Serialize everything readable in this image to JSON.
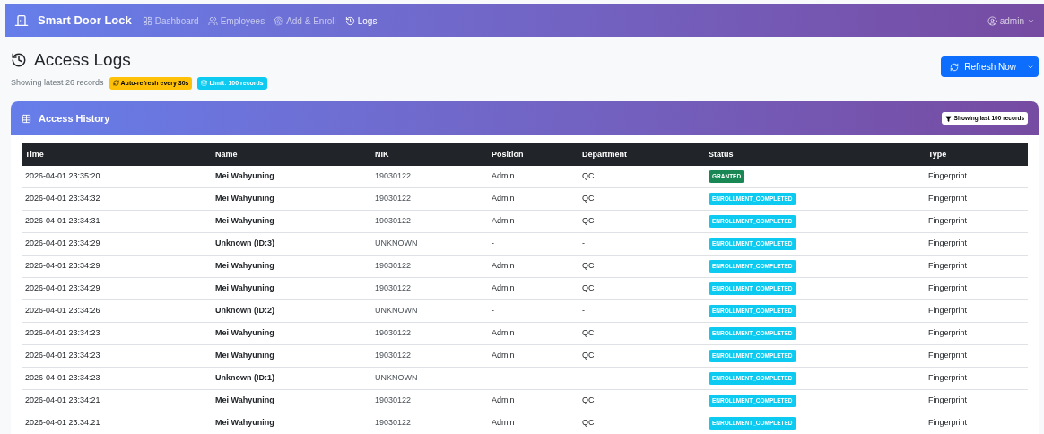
{
  "navbar": {
    "brand": "Smart Door Lock",
    "items": [
      {
        "label": "Dashboard",
        "kind": "dashboard",
        "selected": false
      },
      {
        "label": "Employees",
        "kind": "users",
        "selected": false
      },
      {
        "label": "Add & Enroll",
        "kind": "enroll",
        "selected": false
      },
      {
        "label": "Logs",
        "kind": "logs",
        "selected": true
      }
    ],
    "user": "admin"
  },
  "header": {
    "title": "Access Logs",
    "subtitle": "Showing latest 26 records",
    "badges": [
      {
        "label": "Auto-refresh every 30s",
        "kind": "warning"
      },
      {
        "label": "Limit: 100 records",
        "kind": "info"
      }
    ],
    "refresh_button": "Refresh Now"
  },
  "card": {
    "title": "Access History",
    "badge": "Showing last 100 records"
  },
  "table": {
    "columns": [
      "Time",
      "Name",
      "NIK",
      "Position",
      "Department",
      "Status",
      "Type"
    ],
    "rows": [
      {
        "time": "2026-04-01 23:35:20",
        "name": "Mei Wahyuning",
        "nik": "19030122",
        "position": "Admin",
        "department": "QC",
        "status": {
          "label": "GRANTED",
          "kind": "granted"
        },
        "type": "Fingerprint"
      },
      {
        "time": "2026-04-01 23:34:32",
        "name": "Mei Wahyuning",
        "nik": "19030122",
        "position": "Admin",
        "department": "QC",
        "status": {
          "label": "ENROLLMENT_COMPLETED",
          "kind": "enrollment"
        },
        "type": "Fingerprint"
      },
      {
        "time": "2026-04-01 23:34:31",
        "name": "Mei Wahyuning",
        "nik": "19030122",
        "position": "Admin",
        "department": "QC",
        "status": {
          "label": "ENROLLMENT_COMPLETED",
          "kind": "enrollment"
        },
        "type": "Fingerprint"
      },
      {
        "time": "2026-04-01 23:34:29",
        "name": "Unknown (ID:3)",
        "nik": "UNKNOWN",
        "position": "-",
        "department": "-",
        "status": {
          "label": "ENROLLMENT_COMPLETED",
          "kind": "enrollment"
        },
        "type": "Fingerprint"
      },
      {
        "time": "2026-04-01 23:34:29",
        "name": "Mei Wahyuning",
        "nik": "19030122",
        "position": "Admin",
        "department": "QC",
        "status": {
          "label": "ENROLLMENT_COMPLETED",
          "kind": "enrollment"
        },
        "type": "Fingerprint"
      },
      {
        "time": "2026-04-01 23:34:29",
        "name": "Mei Wahyuning",
        "nik": "19030122",
        "position": "Admin",
        "department": "QC",
        "status": {
          "label": "ENROLLMENT_COMPLETED",
          "kind": "enrollment"
        },
        "type": "Fingerprint"
      },
      {
        "time": "2026-04-01 23:34:26",
        "name": "Unknown (ID:2)",
        "nik": "UNKNOWN",
        "position": "-",
        "department": "-",
        "status": {
          "label": "ENROLLMENT_COMPLETED",
          "kind": "enrollment"
        },
        "type": "Fingerprint"
      },
      {
        "time": "2026-04-01 23:34:23",
        "name": "Mei Wahyuning",
        "nik": "19030122",
        "position": "Admin",
        "department": "QC",
        "status": {
          "label": "ENROLLMENT_COMPLETED",
          "kind": "enrollment"
        },
        "type": "Fingerprint"
      },
      {
        "time": "2026-04-01 23:34:23",
        "name": "Mei Wahyuning",
        "nik": "19030122",
        "position": "Admin",
        "department": "QC",
        "status": {
          "label": "ENROLLMENT_COMPLETED",
          "kind": "enrollment"
        },
        "type": "Fingerprint"
      },
      {
        "time": "2026-04-01 23:34:23",
        "name": "Unknown (ID:1)",
        "nik": "UNKNOWN",
        "position": "-",
        "department": "-",
        "status": {
          "label": "ENROLLMENT_COMPLETED",
          "kind": "enrollment"
        },
        "type": "Fingerprint"
      },
      {
        "time": "2026-04-01 23:34:21",
        "name": "Mei Wahyuning",
        "nik": "19030122",
        "position": "Admin",
        "department": "QC",
        "status": {
          "label": "ENROLLMENT_COMPLETED",
          "kind": "enrollment"
        },
        "type": "Fingerprint"
      },
      {
        "time": "2026-04-01 23:34:21",
        "name": "Mei Wahyuning",
        "nik": "19030122",
        "position": "Admin",
        "department": "QC",
        "status": {
          "label": "ENROLLMENT_COMPLETED",
          "kind": "enrollment"
        },
        "type": "Fingerprint"
      }
    ]
  }
}
